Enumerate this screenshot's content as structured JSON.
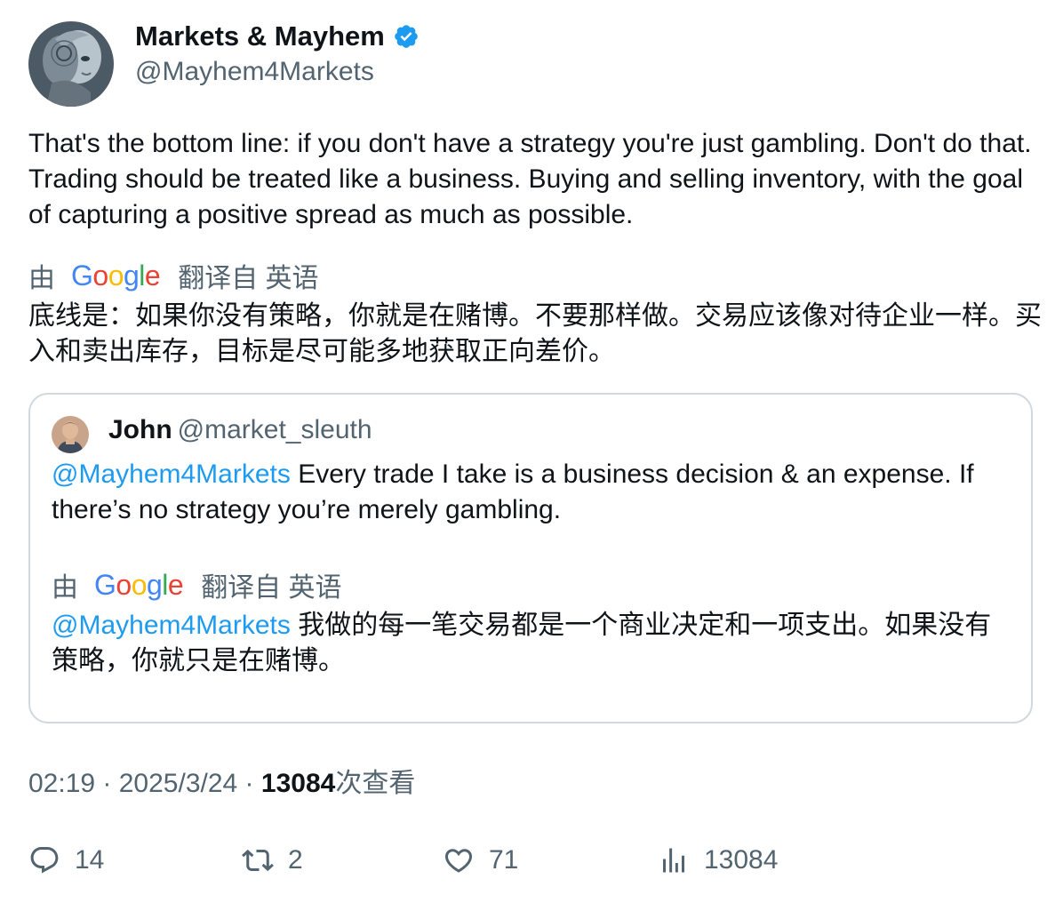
{
  "author": {
    "display_name": "Markets & Mayhem",
    "handle": "@Mayhem4Markets",
    "verified_icon": "verified-badge-icon"
  },
  "tweet": {
    "text": "That's the bottom line: if you don't have a strategy you're just gambling. Don't do that. Trading should be treated like a business. Buying and selling inventory, with the goal of capturing a positive spread as much as possible.",
    "translation": {
      "by_label": "由",
      "provider": "Google",
      "from_label": "翻译自 英语",
      "text": "底线是：如果你没有策略，你就是在赌博。不要那样做。交易应该像对待企业一样。买入和卖出库存，目标是尽可能多地获取正向差价。"
    }
  },
  "quote": {
    "display_name": "John",
    "handle": "@market_sleuth",
    "mention": "@Mayhem4Markets",
    "text": " Every trade I take is a business decision & an expense. If there’s no strategy you’re merely gambling.",
    "translation": {
      "by_label": "由",
      "provider": "Google",
      "from_label": "翻译自 英语",
      "mention": "@Mayhem4Markets",
      "text": " 我做的每一笔交易都是一个商业决定和一项支出。如果没有策略，你就只是在赌博。"
    }
  },
  "meta": {
    "time": "02:19",
    "sep1": " · ",
    "date": "2025/3/24",
    "sep2": " · ",
    "views_count": "13084",
    "views_label": "次查看"
  },
  "actions": {
    "replies": "14",
    "retweets": "2",
    "likes": "71",
    "views": "13084"
  },
  "colors": {
    "link": "#1d9bf0",
    "secondary_text": "#536471",
    "primary_text": "#0f1419",
    "border": "#cfd9de",
    "google_blue": "#4285F4",
    "google_red": "#EA4335",
    "google_yellow": "#FBBC05",
    "google_green": "#34A853"
  }
}
